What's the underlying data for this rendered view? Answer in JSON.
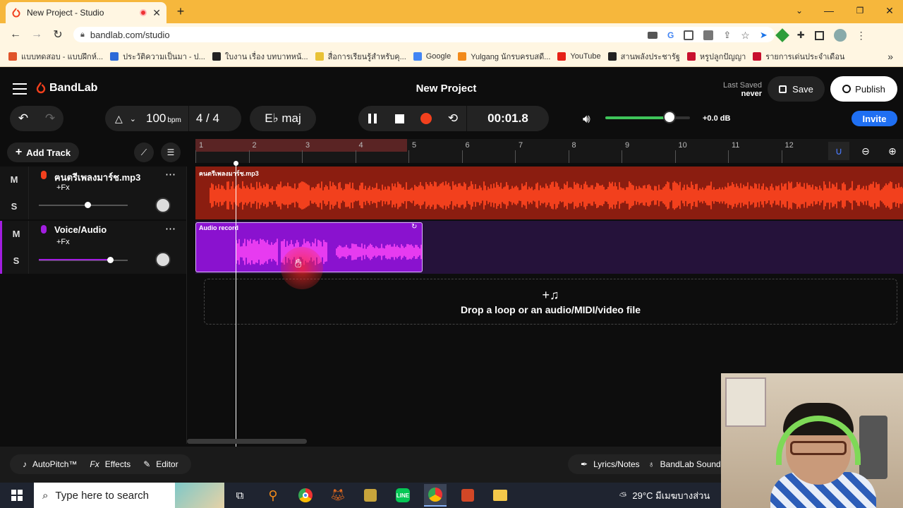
{
  "browser": {
    "tab_title": "New Project - Studio",
    "url": "bandlab.com/studio",
    "bookmarks": [
      {
        "label": "แบบทดสอบ - แบบฝึกห์...",
        "color": "#e0542a"
      },
      {
        "label": "ประวัติความเป็นมา - ป...",
        "color": "#2c6bd8"
      },
      {
        "label": "ใบงาน เรื่อง บทบาทหน้...",
        "color": "#222222"
      },
      {
        "label": "สื่อการเรียนรู้สำหรับคุ...",
        "color": "#e9c236"
      },
      {
        "label": "Google",
        "color": "#4285f4"
      },
      {
        "label": "Yulgang นักรบครบสดี...",
        "color": "#f28a1a"
      },
      {
        "label": "YouTube",
        "color": "#e62117"
      },
      {
        "label": "สานพลังประชารัฐ",
        "color": "#222222"
      },
      {
        "label": "หรูปลูกปัญญา",
        "color": "#c8102e"
      },
      {
        "label": "รายการเด่นประจำเดือน",
        "color": "#c8102e"
      }
    ]
  },
  "app": {
    "brand": "BandLab",
    "project_title": "New Project",
    "last_saved_label": "Last Saved",
    "last_saved_value": "never",
    "save_label": "Save",
    "publish_label": "Publish",
    "invite_label": "Invite",
    "tempo_value": "100",
    "tempo_unit": "bpm",
    "time_signature": "4 / 4",
    "key": "E♭ maj",
    "time": "00:01.8",
    "volume_db": "+0.0 dB",
    "volume_level": 0.76,
    "add_track_label": "Add Track",
    "drop_text": "Drop a loop or an audio/MIDI/video file",
    "ruler_ticks": [
      "1",
      "2",
      "3",
      "4",
      "5",
      "6",
      "7",
      "8",
      "9",
      "10",
      "11",
      "12"
    ],
    "colors": {
      "accent_red": "#f2401d",
      "accent_purple": "#a21ee0",
      "invite_blue": "#1f6ff2"
    },
    "tracks": [
      {
        "name": "ฅนตรีเพลงมาร์ช.mp3",
        "fx": "+Fx",
        "mute": "M",
        "solo": "S",
        "clip_label": "ฅนตรีเพลงมาร์ช.mp3",
        "volume": 0.55,
        "color": "#f2401d"
      },
      {
        "name": "Voice/Audio",
        "fx": "+Fx",
        "mute": "M",
        "solo": "S",
        "clip_label": "Audio record",
        "volume": 0.8,
        "color": "#a21ee0"
      }
    ],
    "bottom": {
      "autopitch": "AutoPitch™",
      "effects": "Effects",
      "editor": "Editor",
      "lyrics": "Lyrics/Notes",
      "sounds": "BandLab Sounds"
    }
  },
  "taskbar": {
    "search_placeholder": "Type here to search",
    "weather": "29°C มีเมฆบางส่วน"
  }
}
